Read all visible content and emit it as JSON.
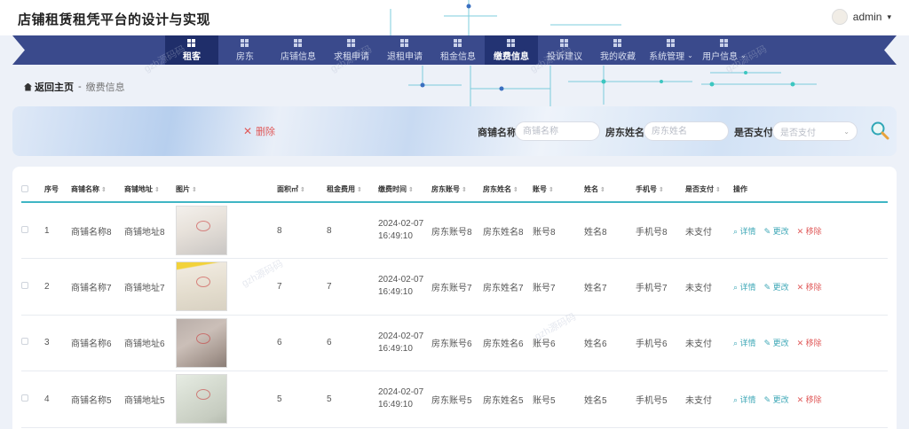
{
  "app": {
    "title": "店铺租赁租凭平台的设计与实现"
  },
  "user": {
    "name": "admin",
    "caret": "▾"
  },
  "nav": {
    "items": [
      {
        "label": "租客",
        "active": true
      },
      {
        "label": "房东"
      },
      {
        "label": "店铺信息"
      },
      {
        "label": "求租申请"
      },
      {
        "label": "退租申请"
      },
      {
        "label": "租金信息"
      },
      {
        "label": "缴费信息",
        "selected": true
      },
      {
        "label": "投诉建议"
      },
      {
        "label": "我的收藏"
      },
      {
        "label": "系统管理",
        "dropdown": true
      },
      {
        "label": "用户信息",
        "dropdown": true
      }
    ]
  },
  "breadcrumb": {
    "home": "返回主页",
    "sep": "-",
    "current": "缴费信息"
  },
  "search": {
    "delete_label": "删除",
    "shop_name_label": "商铺名称",
    "shop_name_placeholder": "商铺名称",
    "owner_name_label": "房东姓名",
    "owner_name_placeholder": "房东姓名",
    "paid_label": "是否支付",
    "paid_placeholder": "是否支付"
  },
  "table": {
    "headers": {
      "index": "序号",
      "shop_name": "商铺名称",
      "shop_addr": "商铺地址",
      "image": "图片",
      "area": "面积㎡",
      "rent": "租金费用",
      "pay_time": "缴费时间",
      "owner_account": "房东账号",
      "owner_name": "房东姓名",
      "account": "账号",
      "name": "姓名",
      "phone": "手机号",
      "paid": "是否支付",
      "action": "操作"
    },
    "actions": {
      "detail": "详情",
      "edit": "更改",
      "remove": "移除"
    },
    "rows": [
      {
        "index": "1",
        "shop_name": "商铺名称8",
        "shop_addr": "商铺地址8",
        "area": "8",
        "rent": "8",
        "pay_time": "2024-02-07 16:49:10",
        "owner_account": "房东账号8",
        "owner_name": "房东姓名8",
        "account": "账号8",
        "name": "姓名8",
        "phone": "手机号8",
        "paid": "未支付"
      },
      {
        "index": "2",
        "shop_name": "商铺名称7",
        "shop_addr": "商铺地址7",
        "area": "7",
        "rent": "7",
        "pay_time": "2024-02-07 16:49:10",
        "owner_account": "房东账号7",
        "owner_name": "房东姓名7",
        "account": "账号7",
        "name": "姓名7",
        "phone": "手机号7",
        "paid": "未支付"
      },
      {
        "index": "3",
        "shop_name": "商铺名称6",
        "shop_addr": "商铺地址6",
        "area": "6",
        "rent": "6",
        "pay_time": "2024-02-07 16:49:10",
        "owner_account": "房东账号6",
        "owner_name": "房东姓名6",
        "account": "账号6",
        "name": "姓名6",
        "phone": "手机号6",
        "paid": "未支付"
      },
      {
        "index": "4",
        "shop_name": "商铺名称5",
        "shop_addr": "商铺地址5",
        "area": "5",
        "rent": "5",
        "pay_time": "2024-02-07 16:49:10",
        "owner_account": "房东账号5",
        "owner_name": "房东姓名5",
        "account": "账号5",
        "name": "姓名5",
        "phone": "手机号5",
        "paid": "未支付"
      }
    ]
  },
  "watermark": "gzh源码码",
  "colors": {
    "nav_bg": "#3a4a8c",
    "nav_active": "#1f2e6a",
    "accent": "#3fb5c4",
    "danger": "#e05a5a"
  }
}
